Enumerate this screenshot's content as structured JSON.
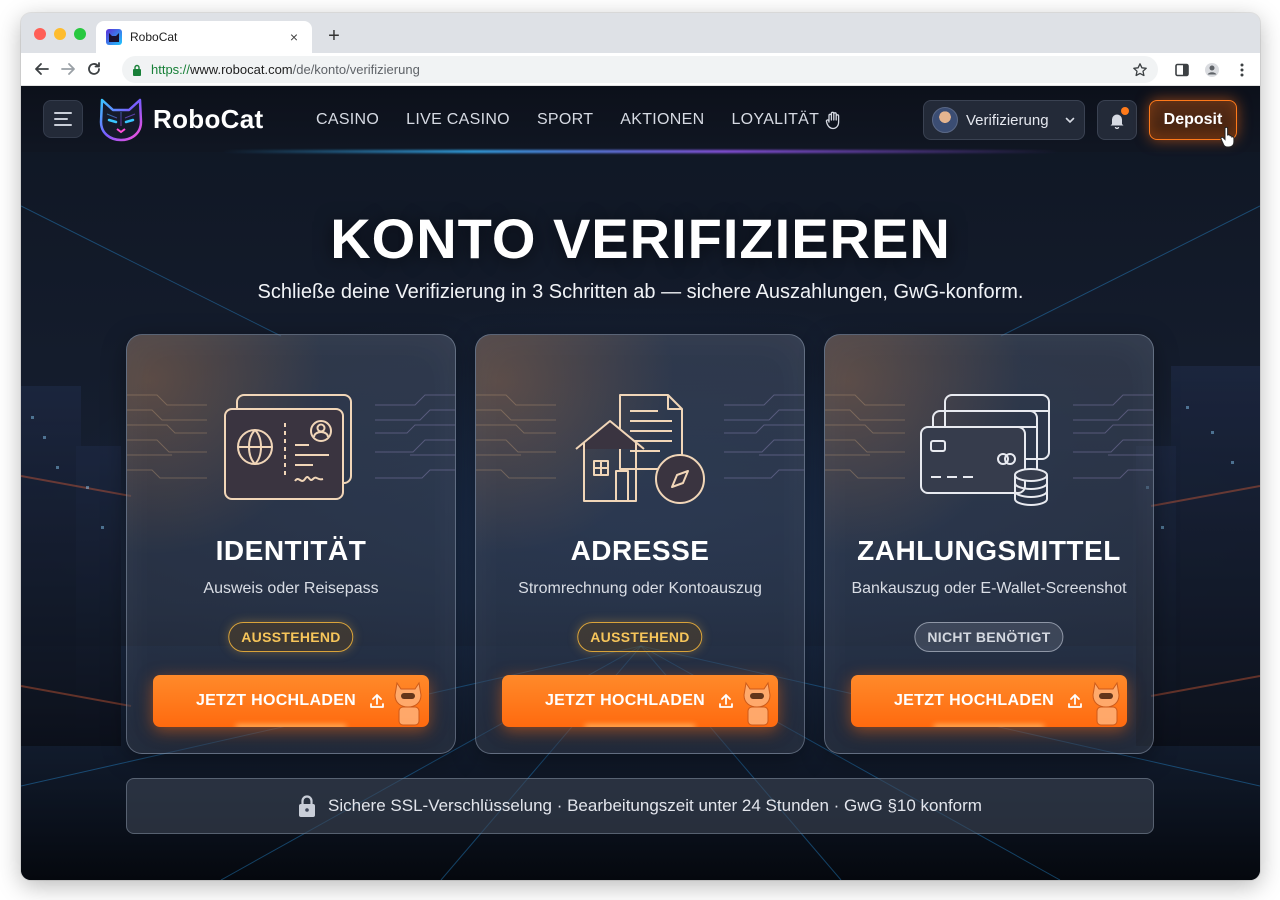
{
  "browser": {
    "tab_title": "RoboCat",
    "tab_close": "×",
    "new_tab": "+",
    "url_scheme": "https://",
    "url_host": "www.robocat.com",
    "url_path": "/de/konto/verifizierung"
  },
  "header": {
    "brand": "RoboCat",
    "nav": [
      "CASINO",
      "LIVE CASINO",
      "SPORT",
      "AKTIONEN",
      "LOYALITÄT"
    ],
    "verification_label": "Verifizierung",
    "deposit_label": "Deposit",
    "accent_color": "#ff7a1a"
  },
  "hero": {
    "title": "KONTO VERIFIZIEREN",
    "subtitle": "Schließe deine Verifizierung in 3 Schritten ab — sichere Auszahlungen, GwG-konform."
  },
  "cards": [
    {
      "icon": "id-card-icon",
      "title": "IDENTITÄT",
      "description": "Ausweis oder Reisepass",
      "status": "AUSSTEHEND",
      "button": "JETZT HOCHLADEN"
    },
    {
      "icon": "house-document-icon",
      "title": "ADRESSE",
      "description": "Stromrechnung oder Kontoauszug",
      "status": "AUSSTEHEND",
      "button": "JETZT HOCHLADEN"
    },
    {
      "icon": "payment-cards-icon",
      "title": "ZAHLUNGSMITTEL",
      "description": "Bankauszug oder E-Wallet-Screenshot",
      "status": "NICHT BENÖTIGT",
      "button": "JETZT HOCHLADEN"
    }
  ],
  "footer": {
    "secure_text": "Sichere SSL-Verschlüsselung · Bearbeitungszeit unter 24 Stunden · GwG §10 konform"
  }
}
